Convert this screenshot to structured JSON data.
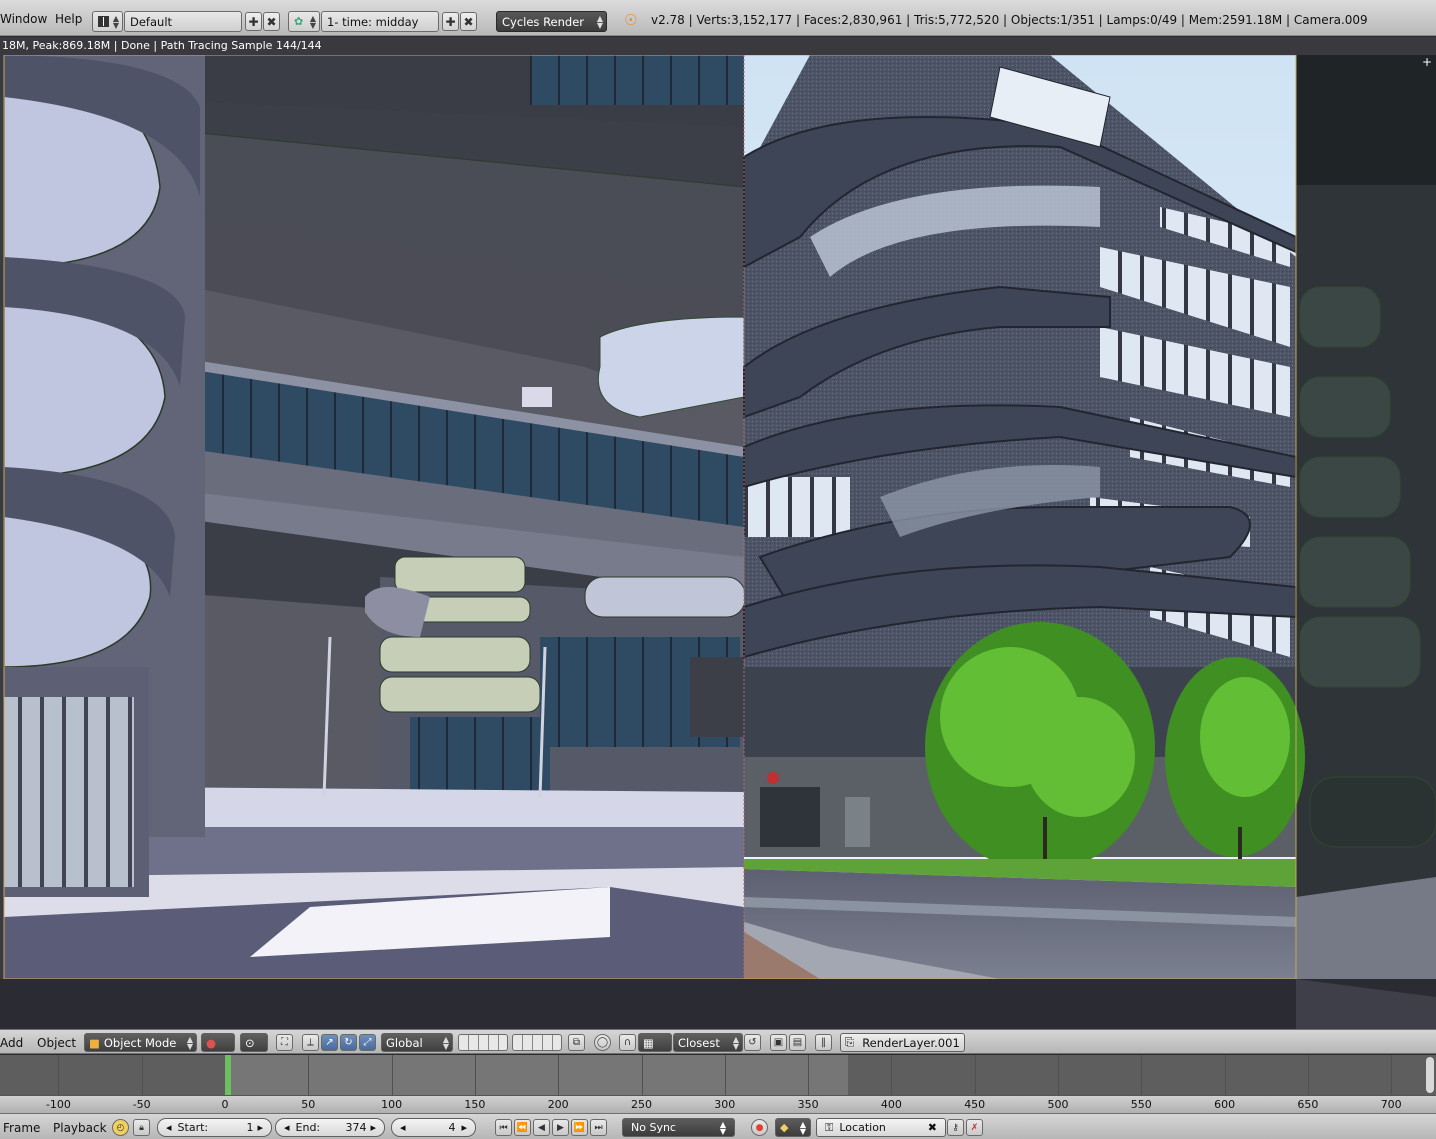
{
  "menus": {
    "window": "Window",
    "help": "Help"
  },
  "screen_layout": {
    "icon": "screen-layout-icon",
    "value": "Default"
  },
  "scene": {
    "icon": "scene-icon",
    "value": "1- time: midday"
  },
  "render_engine": {
    "value": "Cycles Render"
  },
  "stats": "v2.78 | Verts:3,152,177 | Faces:2,830,961 | Tris:5,772,520 | Objects:1/351 | Lamps:0/49 | Mem:2591.18M | Camera.009",
  "render_status": "18M, Peak:869.18M | Done | Path Tracing Sample 144/144",
  "view3d_header": {
    "add": "Add",
    "object": "Object",
    "mode": "Object Mode",
    "orientation": "Global",
    "snap_target": "Closest",
    "render_layer": "RenderLayer.001"
  },
  "timeline": {
    "ticks": [
      "-100",
      "-50",
      "0",
      "50",
      "100",
      "150",
      "200",
      "250",
      "300",
      "350",
      "400",
      "450",
      "500",
      "550",
      "600",
      "650",
      "700"
    ],
    "current_frame_marker": 0,
    "range_start": 1,
    "range_end": 374
  },
  "timeline_header": {
    "frame": "Frame",
    "playback": "Playback",
    "start_label": "Start:",
    "start_value": "1",
    "end_label": "End:",
    "end_value": "374",
    "current_frame": "4",
    "sync": "No Sync",
    "keying_set": "Location"
  },
  "colors": {
    "accent": "#6cc060",
    "header_bg": "#c8c8c8",
    "dark_field": "#4a4a4a",
    "viewport_bg": "#3a3a42"
  }
}
